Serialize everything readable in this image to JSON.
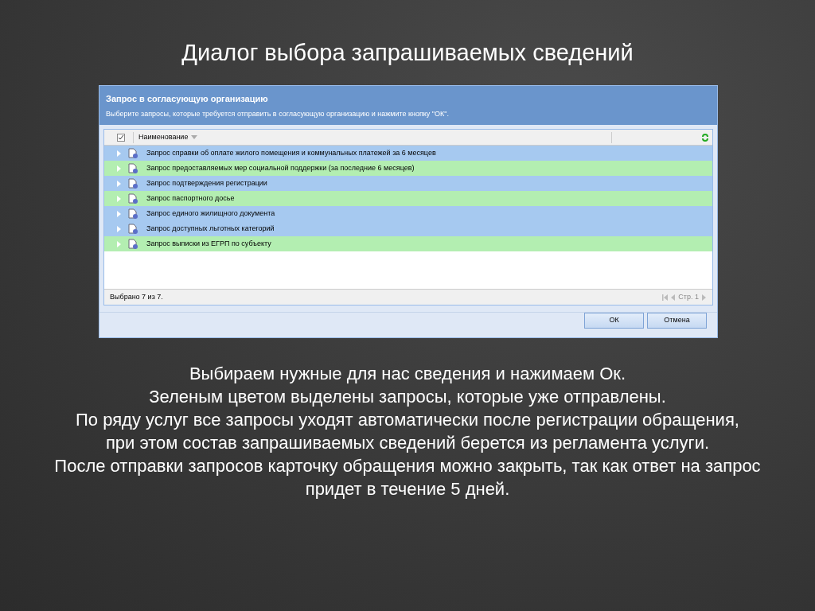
{
  "slide_title": "Диалог выбора запрашиваемых сведений",
  "dialog": {
    "title": "Запрос в согласующую организацию",
    "instruction": "Выберите запросы, которые требуется отправить в согласующую организацию и нажмите кнопку \"ОК\".",
    "header_checkbox": {
      "checked": true
    },
    "column_1": "Наименование",
    "rows": [
      {
        "name": "Запрос справки об оплате жилого помещения и коммунальных платежей за 6 месяцев",
        "sent": false
      },
      {
        "name": "Запрос предоставляемых мер социальной поддержки (за последние 6 месяцев)",
        "sent": true
      },
      {
        "name": "Запрос подтверждения регистрации",
        "sent": false
      },
      {
        "name": "Запрос паспортного досье",
        "sent": true
      },
      {
        "name": "Запрос единого жилищного документа",
        "sent": false
      },
      {
        "name": "Запрос доступных льготных категорий",
        "sent": false
      },
      {
        "name": "Запрос выписки из ЕГРП по субъекту",
        "sent": true
      }
    ],
    "status": "Выбрано 7 из 7.",
    "page": "Стр. 1",
    "buttons": [
      "ОК",
      "Отмена"
    ]
  },
  "paragraphs": [
    "Выбираем нужные для нас сведения и нажимаем Ок.",
    "Зеленым цветом выделены запросы, которые уже отправлены.",
    "По ряду услуг все запросы уходят автоматически после регистрации обращения, при этом состав запрашиваемых сведений берется из регламента услуги.",
    "После отправки запросов карточку обращения можно закрыть, так как ответ на запрос придет в течение 5 дней."
  ]
}
